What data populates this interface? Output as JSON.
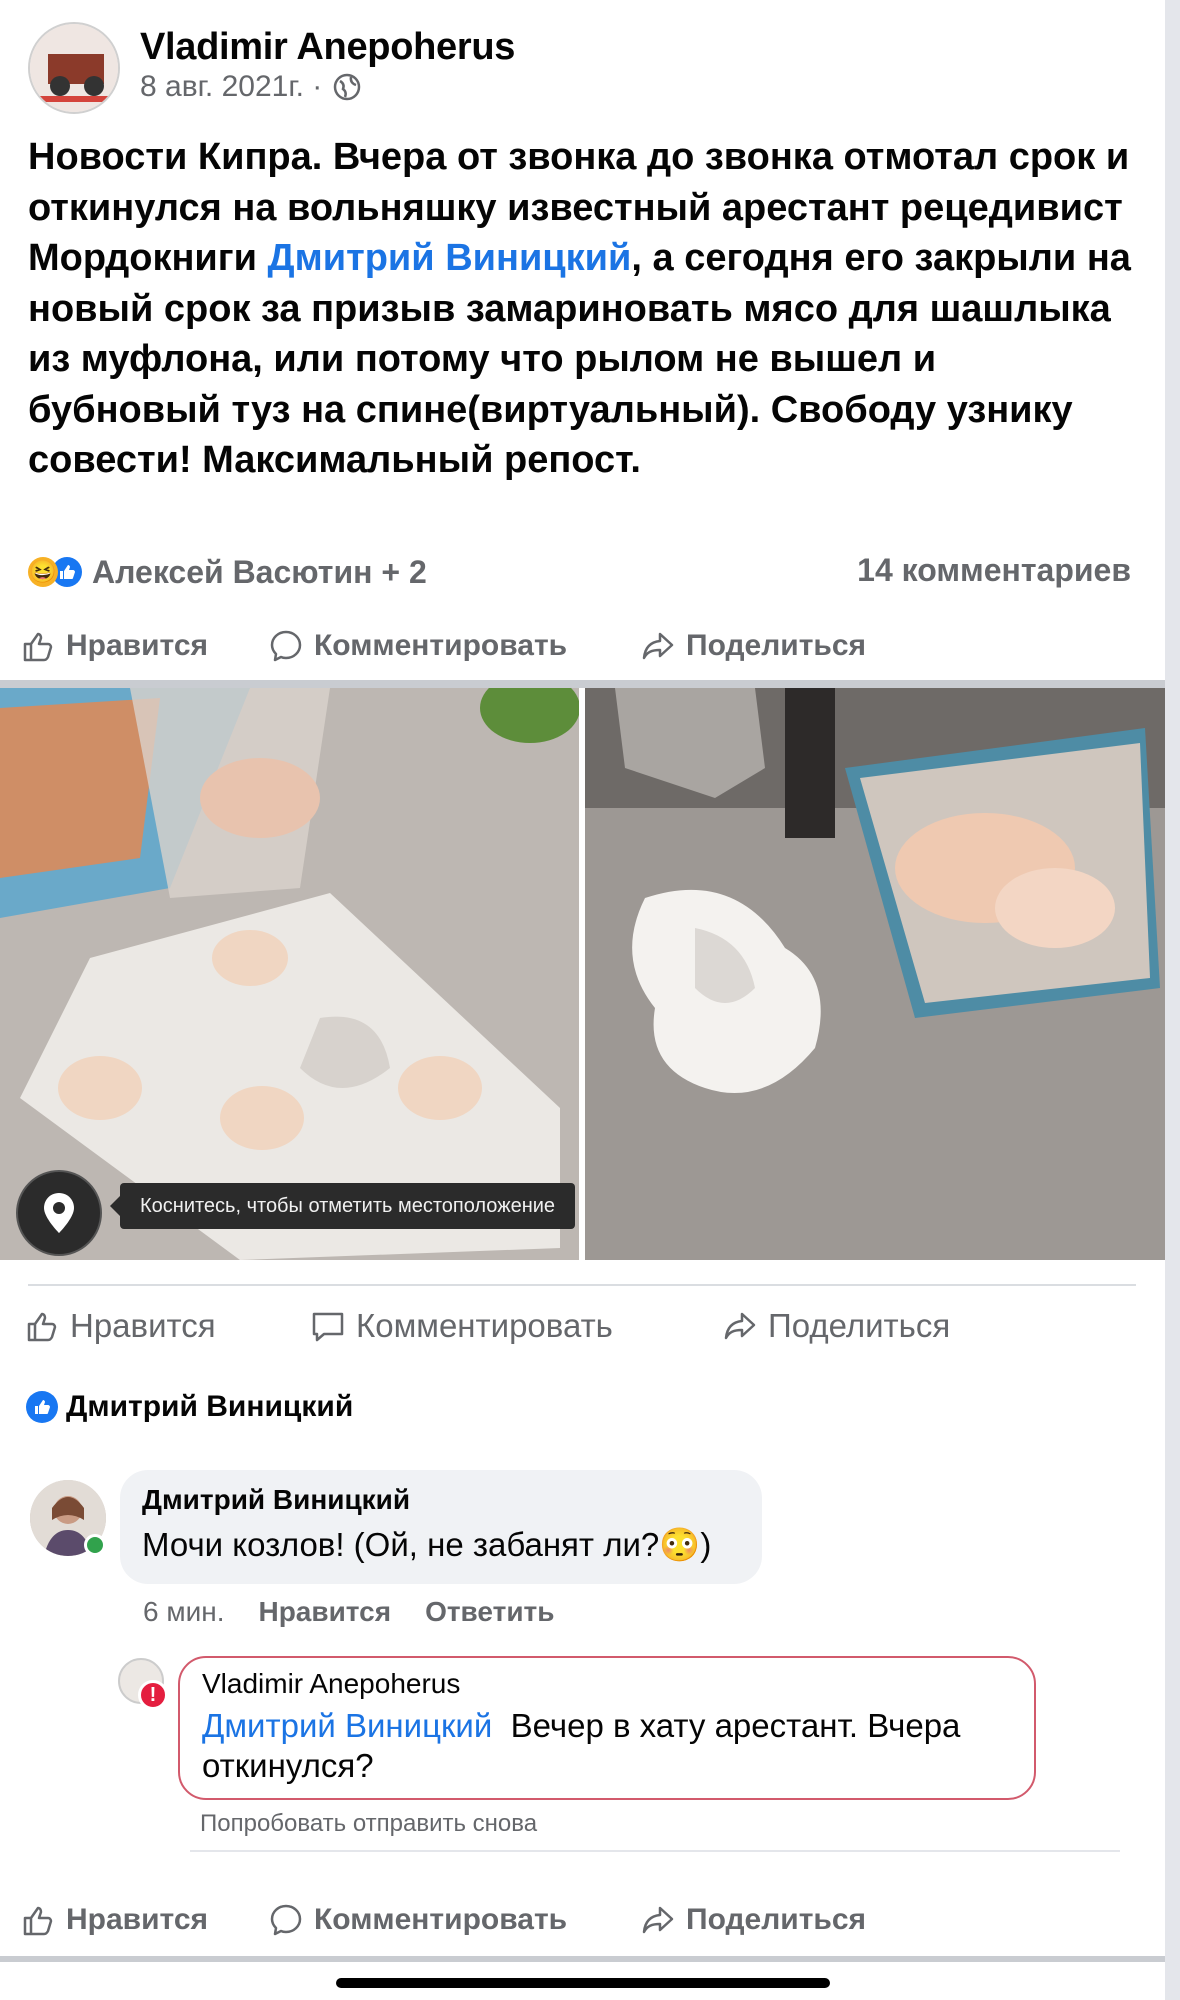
{
  "post": {
    "author": "Vladimir Anepoherus",
    "date": "8 авг. 2021г. ·",
    "text_before": "Новости Кипра. Вчера от звонка до звонка отмотал срок и откинулся на вольняшку известный арестант рецедивист Мордокниги ",
    "mention": "Дмитрий Виницкий",
    "text_after": ", а сегодня его закрыли на новый срок за призыв замариновать мясо для шашлыка из муфлона, или потому что рылом не вышел и бубновый туз на спине(виртуальный). Свободу узнику совести! Максимальный репост.",
    "reactions_names": "Алексей Васютин + 2",
    "comments_count": "14 комментариев"
  },
  "actions_top": {
    "like": "Нравится",
    "comment": "Комментировать",
    "share": "Поделиться"
  },
  "photos": {
    "location_tip": "Коснитесь, чтобы отметить местоположение"
  },
  "actions_mid": {
    "like": "Нравится",
    "comment": "Комментировать",
    "share": "Поделиться"
  },
  "reaction_user": "Дмитрий Виницкий",
  "comment": {
    "author": "Дмитрий Виницкий",
    "text": "Мочи козлов! (Ой, не забанят ли?😳)",
    "time": "6 мин.",
    "like": "Нравится",
    "reply": "Ответить"
  },
  "reply": {
    "author": "Vladimir Anepoherus",
    "mention": "Дмитрий Виницкий",
    "text": "Вечер в хату арестант. Вчера откинулся?",
    "retry": "Попробовать отправить снова"
  },
  "actions_bottom": {
    "like": "Нравится",
    "comment": "Комментировать",
    "share": "Поделиться"
  },
  "colors": {
    "link": "#1b74e4",
    "muted": "#65676b",
    "error": "#e41e3f",
    "online": "#31a24c"
  }
}
